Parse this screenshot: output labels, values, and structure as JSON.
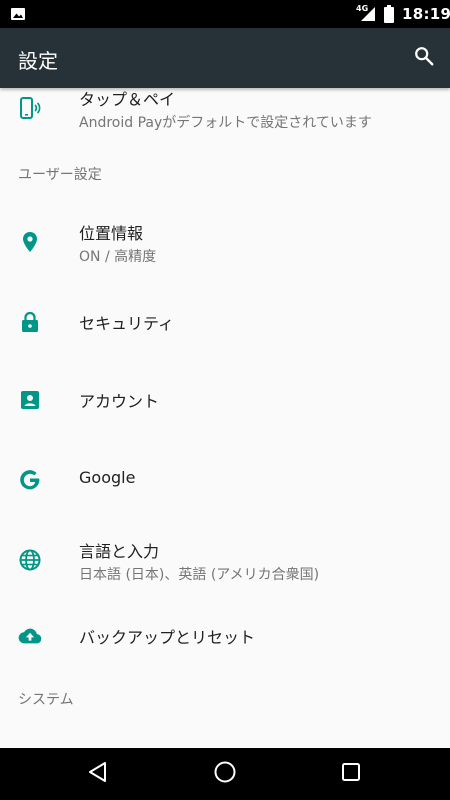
{
  "status_bar": {
    "network": "4G",
    "time": "18:19"
  },
  "app_bar": {
    "title": "設定",
    "search_icon": "search-icon"
  },
  "accent_color": "#009688",
  "items": [
    {
      "icon": "nfc-tap-pay-icon",
      "label": "タップ＆ペイ",
      "summary": "Android Payがデフォルトで設定されています"
    },
    {
      "icon": "location-pin-icon",
      "label": "位置情報",
      "summary": "ON / 高精度"
    },
    {
      "icon": "lock-icon",
      "label": "セキュリティ",
      "summary": ""
    },
    {
      "icon": "account-box-icon",
      "label": "アカウント",
      "summary": ""
    },
    {
      "icon": "google-g-icon",
      "label": "Google",
      "summary": ""
    },
    {
      "icon": "globe-language-icon",
      "label": "言語と入力",
      "summary": "日本語 (日本)、英語 (アメリカ合衆国)"
    },
    {
      "icon": "cloud-upload-icon",
      "label": "バックアップとリセット",
      "summary": ""
    }
  ],
  "sections": {
    "user_settings": "ユーザー設定",
    "system": "システム"
  },
  "nav_bar": {
    "back_icon": "back-triangle-icon",
    "home_icon": "home-circle-icon",
    "recents_icon": "recents-square-icon"
  }
}
